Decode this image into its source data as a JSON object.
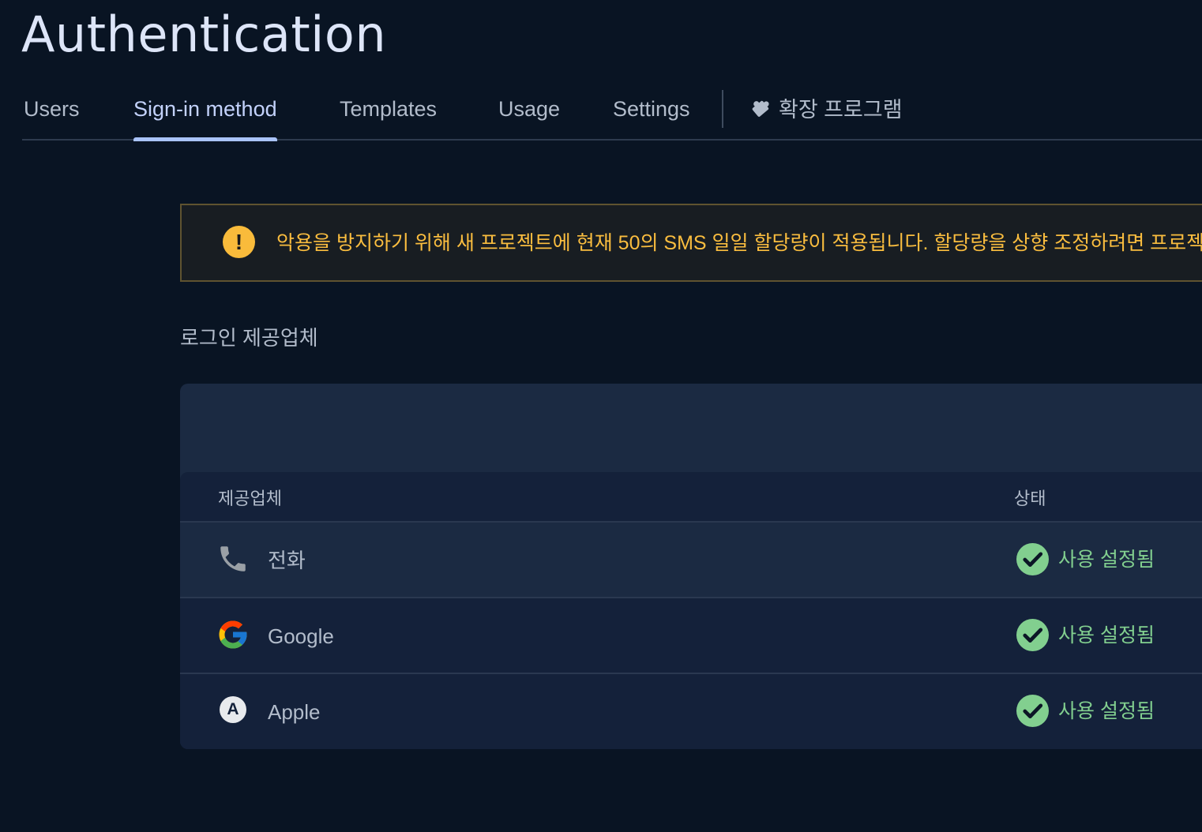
{
  "page": {
    "title": "Authentication"
  },
  "tabs": [
    {
      "label": "Users"
    },
    {
      "label": "Sign-in method"
    },
    {
      "label": "Templates"
    },
    {
      "label": "Usage"
    },
    {
      "label": "Settings"
    },
    {
      "label": "확장 프로그램",
      "icon": "extension-puzzle-icon"
    }
  ],
  "active_tab": "Sign-in method",
  "warning": {
    "icon": "exclamation-icon",
    "text": "악용을 방지하기 위해 새 프로젝트에 현재 50의 SMS 일일 할당량이 적용됩니다. 할당량을 상향 조정하려면 프로젝트에 결제 계정을 연결하세요."
  },
  "providers_section": {
    "title": "로그인 제공업체",
    "columns": {
      "provider": "제공업체",
      "status": "상태"
    },
    "rows": [
      {
        "name": "전화",
        "icon": "phone-icon",
        "status": "사용 설정됨"
      },
      {
        "name": "Google",
        "icon": "google-logo-icon",
        "status": "사용 설정됨"
      },
      {
        "name": "Apple",
        "icon": "apple-badge-icon",
        "badge": "A",
        "status": "사용 설정됨"
      }
    ]
  },
  "colors": {
    "background": "#091423",
    "accent": "#a9c3fb",
    "warning": "#fabd3f",
    "enabled": "#82cf8f"
  }
}
